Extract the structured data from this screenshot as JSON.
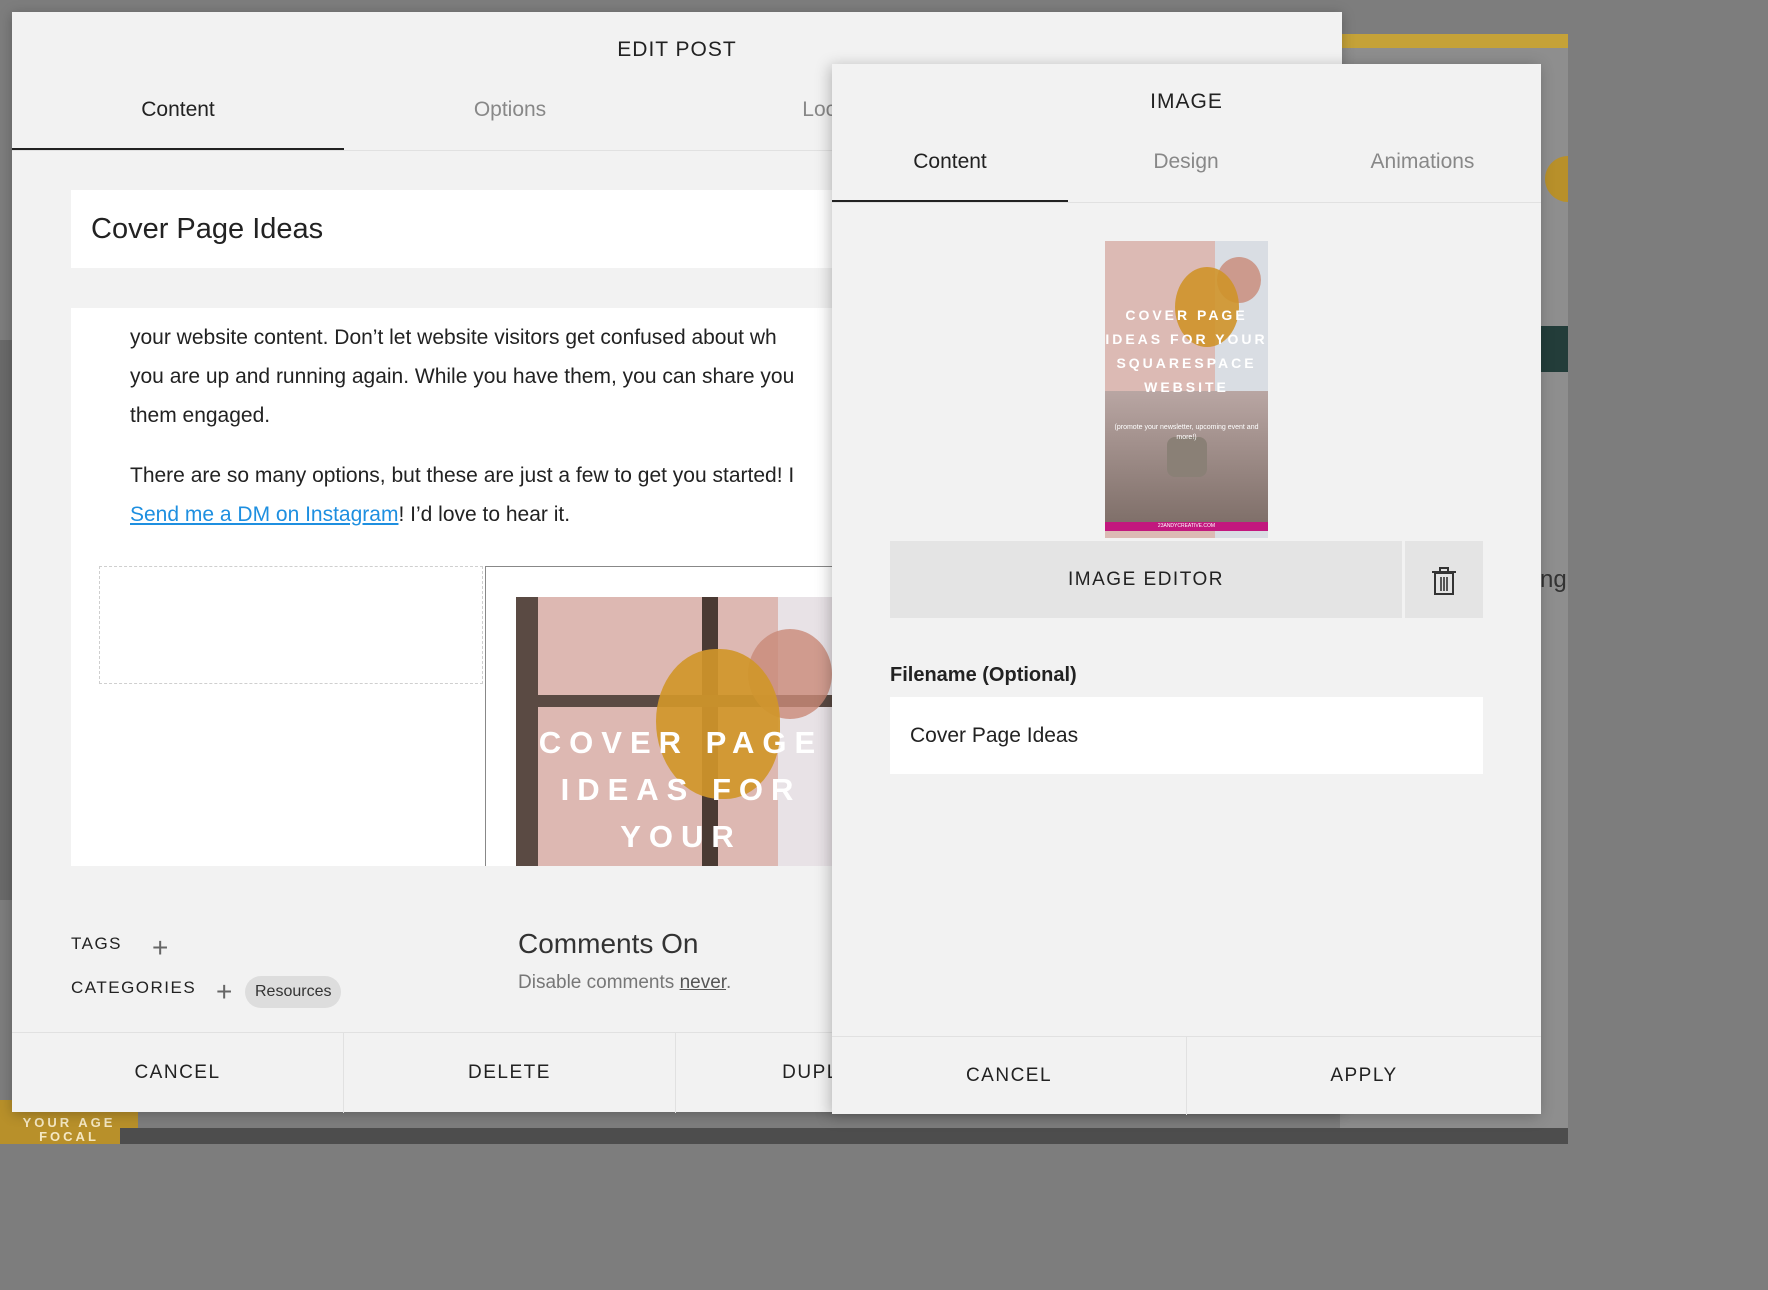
{
  "edit_post": {
    "title": "EDIT POST",
    "tabs": [
      {
        "label": "Content"
      },
      {
        "label": "Options"
      },
      {
        "label": "Location"
      }
    ],
    "post_title": "Cover Page Ideas",
    "body": {
      "line1": "your website content. Don’t let website visitors get confused about wh",
      "line2": "you are up and running again. While you have them, you can share you",
      "line3": "them engaged.",
      "line4": "There are so many options, but these are just a few to get you started! I",
      "link_text": "Send me a DM on Instagram",
      "line5_rest": "! I’d love to hear it."
    },
    "embedded_image_text": "COVER PAGE IDEAS FOR YOUR",
    "tags_label": "TAGS",
    "categories_label": "CATEGORIES",
    "category_badge": "Resources",
    "comments_title": "Comments On",
    "comments_sub_prefix": "Disable comments",
    "comments_sub_link": "never",
    "comments_sub_suffix": ".",
    "footer": {
      "cancel": "CANCEL",
      "delete": "DELETE",
      "duplicate": "DUPLICATE"
    }
  },
  "image_panel": {
    "title": "IMAGE",
    "tabs": [
      {
        "label": "Content"
      },
      {
        "label": "Design"
      },
      {
        "label": "Animations"
      }
    ],
    "thumb_text": "COVER PAGE IDEAS FOR YOUR SQUARESPACE WEBSITE",
    "thumb_small": "(promote your newsletter, upcoming event and more!)",
    "thumb_footer": "23ANDYCREATIVE.COM",
    "image_editor_label": "IMAGE EDITOR",
    "filename_label": "Filename (Optional)",
    "filename_value": "Cover Page Ideas",
    "footer": {
      "cancel": "CANCEL",
      "apply": "APPLY"
    }
  },
  "background": {
    "foot_text": "YOUR AGE FOCAL",
    "side_text": "ng"
  },
  "colors": {
    "link": "#1e8fe0",
    "gold": "#c5a238",
    "panel_bg": "#f2f2f2"
  }
}
